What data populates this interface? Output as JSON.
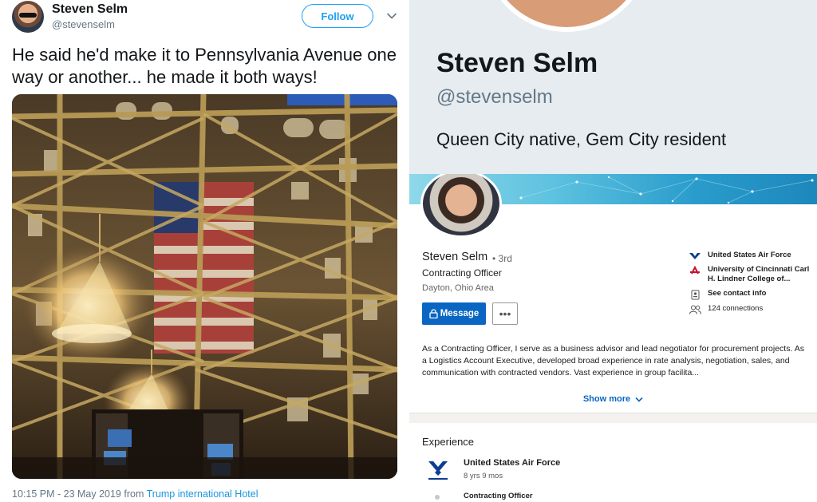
{
  "tweet": {
    "display_name": "Steven Selm",
    "handle": "@stevenselm",
    "follow_label": "Follow",
    "text": "He said he'd make it to Pennsylvania Avenue one way or another... he made it both ways!",
    "timestamp": "10:15 PM - 23 May 2019 from ",
    "source": "Trump international Hotel",
    "colors": {
      "accent": "#1da1f2",
      "secondary_text": "#657786"
    }
  },
  "twitter_profile": {
    "name": "Steven Selm",
    "handle": "@stevenselm",
    "bio": "Queen City native, Gem City resident"
  },
  "linkedin": {
    "name": "Steven Selm",
    "degree": "• 3rd",
    "headline": "Contracting Officer",
    "location": "Dayton, Ohio Area",
    "message_label": "Message",
    "more_label": "•••",
    "side": [
      {
        "icon": "usaf-logo-icon",
        "text": "United States Air Force"
      },
      {
        "icon": "university-logo-icon",
        "text": "University of Cincinnati Carl H. Lindner College of..."
      },
      {
        "icon": "contact-card-icon",
        "text": "See contact info"
      },
      {
        "icon": "people-icon",
        "text": "124 connections"
      }
    ],
    "about": "As a Contracting Officer, I serve as a business advisor and lead negotiator for procurement projects. As a Logistics Account Executive, developed broad experience in rate analysis, negotiation, sales, and communication with contracted vendors. Vast experience in group facilita...",
    "show_more_label": "Show more",
    "experience": {
      "title": "Experience",
      "company": "United States Air Force",
      "duration": "8 yrs 9 mos",
      "role": "Contracting Officer"
    },
    "colors": {
      "primary": "#0a66c2"
    }
  }
}
